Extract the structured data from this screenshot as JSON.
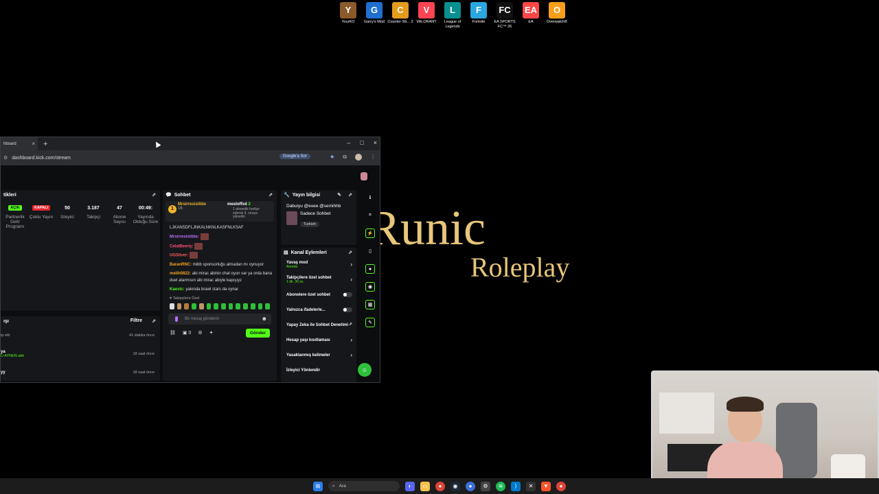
{
  "desktop_icons": [
    {
      "label": "YourKO",
      "color": "#8b5a2b",
      "glyph": "Y"
    },
    {
      "label": "Garry's Mod",
      "color": "#1f6fd1",
      "glyph": "G"
    },
    {
      "label": "Counter-Str... 2",
      "color": "#e39b1c",
      "glyph": "C"
    },
    {
      "label": "VALORANT",
      "color": "#fa4454",
      "glyph": "V"
    },
    {
      "label": "League of Legends",
      "color": "#0a8f8f",
      "glyph": "L"
    },
    {
      "label": "Fortnite",
      "color": "#2aa7e0",
      "glyph": "F"
    },
    {
      "label": "EA SPORTS FC™ 26",
      "color": "#111111",
      "glyph": "FC"
    },
    {
      "label": "EA",
      "color": "#ff4747",
      "glyph": "EA"
    },
    {
      "label": "Overwatch®",
      "color": "#f99e1a",
      "glyph": "O"
    }
  ],
  "wallpaper": {
    "title": "Runic",
    "subtitle": "Roleplay"
  },
  "browser": {
    "tab_label": "hboard",
    "url": "dashboard.kick.com/stream",
    "google_button": "Google'a Sor"
  },
  "stats": {
    "title": "tikleri",
    "items": [
      {
        "value": "AÇIK",
        "label": "Partnerlik Gelir Programı",
        "kind": "green"
      },
      {
        "value": "KAPALI",
        "label": "Çoklu Yayın",
        "kind": "red"
      },
      {
        "value": "50",
        "label": "İzleyici",
        "kind": "plain"
      },
      {
        "value": "3.187",
        "label": "Takipçi",
        "kind": "plain"
      },
      {
        "value": "47",
        "label": "Abone Sayısı",
        "kind": "plain"
      },
      {
        "value": "00:49:",
        "label": "Yayında Olduğu Süre",
        "kind": "plain"
      }
    ]
  },
  "activity": {
    "title": "ışı",
    "filter": "Filtre",
    "rows": [
      {
        "name": "",
        "action": "ip etti",
        "time": "41 dakika önce"
      },
      {
        "name": "ya",
        "action": "Ü AYNEN aldı",
        "time": "18 saat önce"
      },
      {
        "name": "yy",
        "action": "",
        "time": "18 saat önce"
      }
    ]
  },
  "chat": {
    "title": "Sohbet",
    "pinned": {
      "badge": "1",
      "user1": "Mrsirresistible",
      "user1_count": "16",
      "user2": "mestoffxd",
      "user2_count": "3",
      "sub_text": "1 abonelik hediye ederek 3. sıraya yükselin"
    },
    "messages": [
      {
        "user": "",
        "text": "LJKANSDFLJNKALNKNLKASFNLKSAF",
        "cls": ""
      },
      {
        "user": "Mrsirresistible:",
        "text": "",
        "cls": "u-purple"
      },
      {
        "user": "CelalBeeriy:",
        "text": "",
        "cls": "u-pink"
      },
      {
        "user": "UGSilver:",
        "text": "",
        "cls": "u-red"
      },
      {
        "user": "BaranRNC:",
        "text": "mibb sponsorluğu almadan mı oynuyor",
        "cls": "u-orange"
      },
      {
        "user": "melih0822:",
        "text": "abi mirac abinin chat oyun var ya orda bana duel atarmısın abi mirac abiyle kapışıyz",
        "cls": "u-orange"
      },
      {
        "user": "Kaovic:",
        "text": "yakında brawl stars da oynar",
        "cls": "u-green"
      }
    ],
    "followers_only": "Takipçilere Özel",
    "input_placeholder": "Bir mesaj gönderin",
    "points": "0",
    "send": "Gönder"
  },
  "stream_info": {
    "title": "Yayın bilgisi",
    "stream_title": "Dabulyu @exee @semihhb",
    "category": "Sadece Sohbet",
    "language": "Turkish"
  },
  "channel_actions": {
    "title": "Kanal Eylemleri",
    "items": [
      {
        "label": "Yavaş mod",
        "sub": "Anında",
        "control": "chevron"
      },
      {
        "label": "Takipçilere özel sohbet",
        "sub": "1 dk. 30 sn.",
        "control": "chevron"
      },
      {
        "label": "Abonelere özel sohbet",
        "sub": "",
        "control": "toggle"
      },
      {
        "label": "Yalnızca ifadelerle...",
        "sub": "",
        "control": "toggle"
      },
      {
        "label": "Yapay Zeka ile Sohbet Denetimi",
        "sub": "",
        "control": "external"
      },
      {
        "label": "Hesap yaşı kısıtlaması",
        "sub": "",
        "control": "chevron"
      },
      {
        "label": "Yasaklanmış kelimeler",
        "sub": "",
        "control": "chevron"
      },
      {
        "label": "İzleyici Yönlendir",
        "sub": "",
        "control": "none"
      }
    ]
  },
  "taskbar": {
    "search": "Ara"
  }
}
